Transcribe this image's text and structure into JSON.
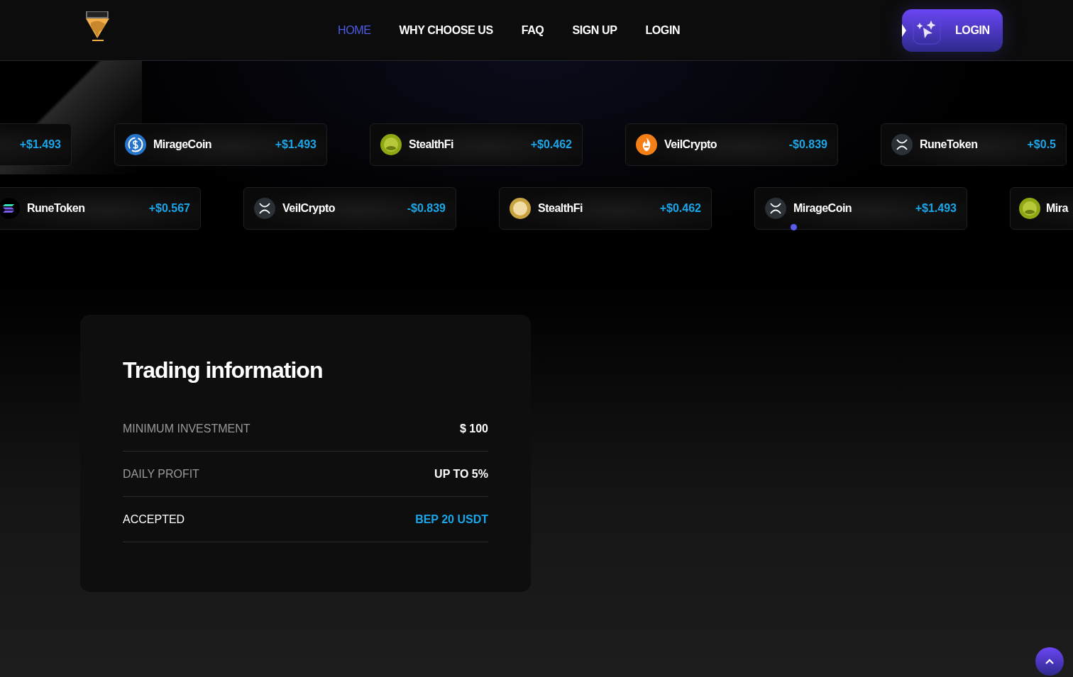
{
  "nav": {
    "links": [
      {
        "label": "HOME",
        "selected": true
      },
      {
        "label": "WHY CHOOSE US",
        "selected": false
      },
      {
        "label": "FAQ",
        "selected": false
      },
      {
        "label": "SIGN UP",
        "selected": false
      },
      {
        "label": "LOGIN",
        "selected": false
      }
    ],
    "button": "LOGIN"
  },
  "ticker_rows": [
    [
      {
        "value": "+$1.493"
      },
      {
        "kind": "dollar",
        "name": "MirageCoin",
        "value": "+$1.493"
      },
      {
        "kind": "frog",
        "name": "StealthFi",
        "value": "+$0.462"
      },
      {
        "kind": "flame",
        "name": "VeilCrypto",
        "value": "-$0.839"
      },
      {
        "kind": "cross",
        "name": "RuneToken",
        "value": "+$0.5"
      }
    ],
    [
      {
        "kind": "stripes",
        "name": "RuneToken",
        "value": "+$0.567"
      },
      {
        "kind": "cross",
        "name": "VeilCrypto",
        "value": "-$0.839"
      },
      {
        "kind": "dog",
        "name": "StealthFi",
        "value": "+$0.462"
      },
      {
        "kind": "cross",
        "name": "MirageCoin",
        "value": "+$1.493"
      },
      {
        "kind": "frog",
        "name": "Mira"
      }
    ]
  ],
  "trading": {
    "title": "Trading information",
    "rows": [
      {
        "label": "MINIMUM INVESTMENT",
        "value": "$ 100",
        "kind": "muted"
      },
      {
        "label": "DAILY PROFIT",
        "value": "UP TO 5%",
        "kind": "muted"
      },
      {
        "label": "ACCEPTED",
        "value": "BEP 20 USDT",
        "kind": "accent"
      }
    ]
  }
}
